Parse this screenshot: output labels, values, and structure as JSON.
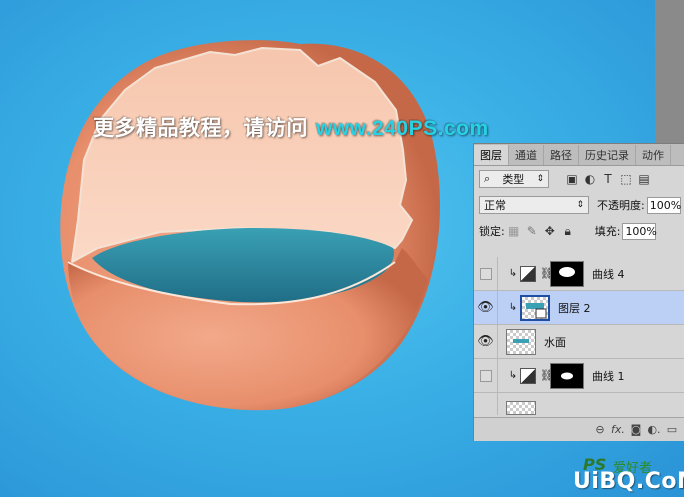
{
  "watermark": {
    "text": "更多精品教程，请访问",
    "site": "www.240PS.com"
  },
  "panel": {
    "tabs": [
      "图层",
      "通道",
      "路径",
      "历史记录",
      "动作"
    ],
    "active_tab": "图层",
    "filter": {
      "label": "类型",
      "icon": "search-icon"
    },
    "blend_mode": "正常",
    "opacity_label": "不透明度:",
    "opacity_value": "100%",
    "lock_label": "锁定:",
    "fill_label": "填充:",
    "fill_value": "100%",
    "layers": [
      {
        "name": "曲线 4",
        "visible": false,
        "type": "curves",
        "clipped": true
      },
      {
        "name": "图层 2",
        "visible": true,
        "type": "smart-object",
        "clipped": true,
        "selected": true
      },
      {
        "name": "水面",
        "visible": true,
        "type": "pixel",
        "clipped": false
      },
      {
        "name": "曲线 1",
        "visible": false,
        "type": "curves",
        "clipped": true
      }
    ]
  },
  "brand": {
    "ps": "PS",
    "hao": "爱好者",
    "site": "UiBQ.CoM"
  },
  "colors": {
    "background": "#3ab0e6",
    "accent_text": "#26d2e4",
    "selected_row": "#bcd0f6"
  }
}
